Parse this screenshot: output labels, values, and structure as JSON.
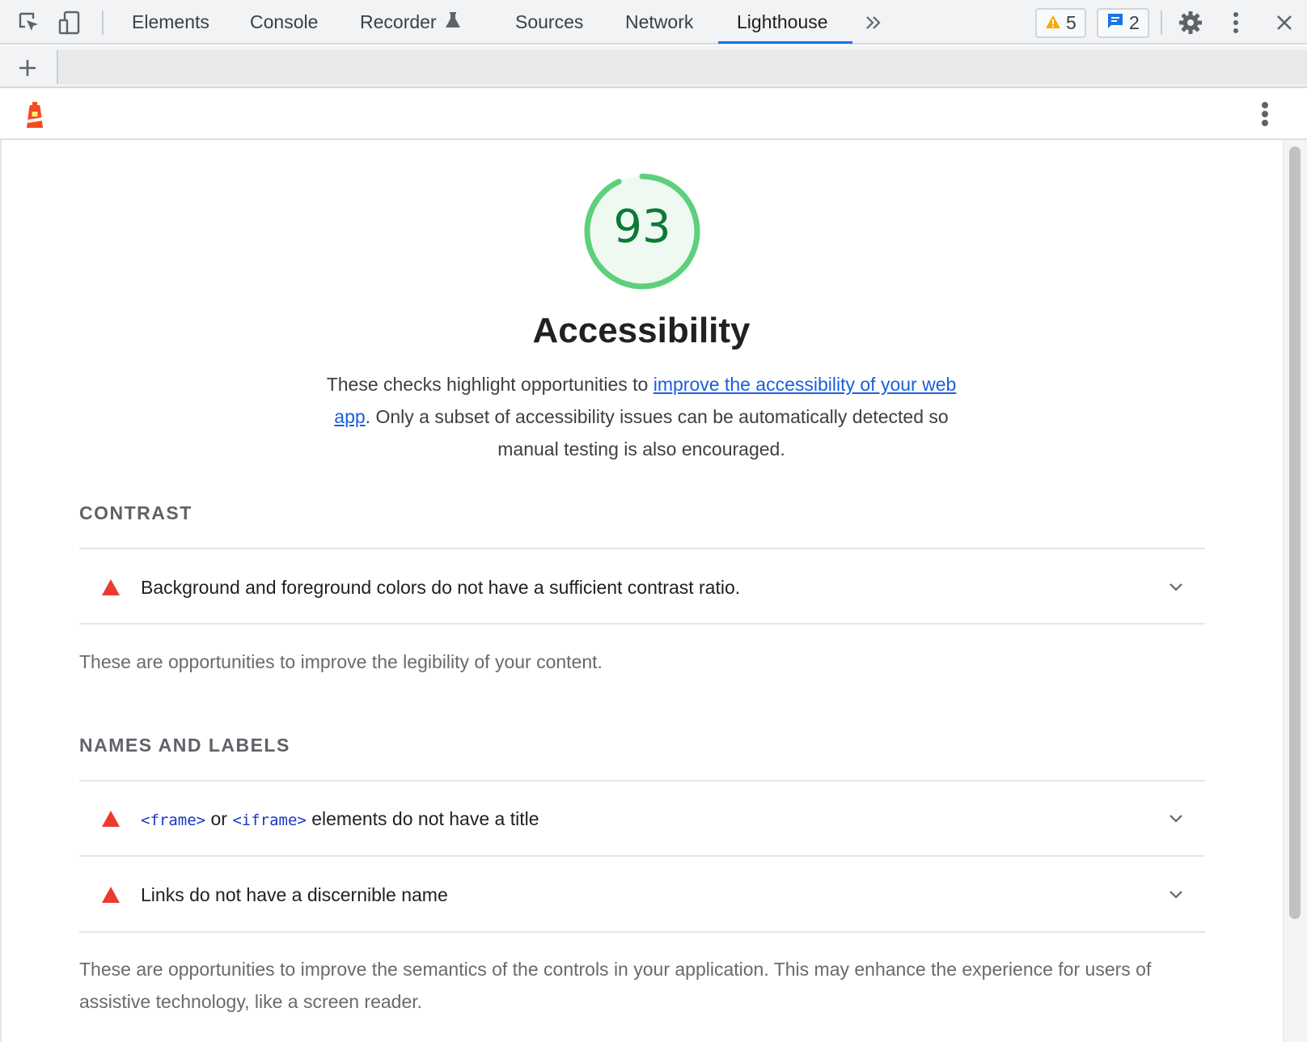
{
  "devtools": {
    "tabs": [
      {
        "label": "Elements"
      },
      {
        "label": "Console"
      },
      {
        "label": "Recorder"
      },
      {
        "label": "Sources"
      },
      {
        "label": "Network"
      },
      {
        "label": "Lighthouse",
        "active": true
      }
    ],
    "icons": [
      "inspect-element-icon",
      "device-toolbar-icon",
      "flask-icon",
      "more-tabs-icon",
      "warning-icon",
      "message-icon",
      "gear-icon",
      "kebab-menu-icon",
      "close-icon"
    ],
    "warnings_count": "5",
    "messages_count": "2",
    "accent_color": "#1a73e8"
  },
  "toolbar": {
    "new_report_icon": "plus-icon",
    "report_select_value": ""
  },
  "report": {
    "logo": "lighthouse-logo",
    "menu_icon": "kebab-menu-icon",
    "score": "93",
    "score_fraction": 0.93,
    "score_color": "#0cce6b",
    "category_title": "Accessibility",
    "description_before": "These checks highlight opportunities to ",
    "description_link": "improve the accessibility of your web app",
    "description_after": ". Only a subset of accessibility issues can be automatically detected so manual testing is also encouraged.",
    "groups": [
      {
        "title": "CONTRAST",
        "audits": [
          {
            "text": "Background and foreground colors do not have a sufficient contrast ratio."
          }
        ],
        "description": "These are opportunities to improve the legibility of your content."
      },
      {
        "title": "NAMES AND LABELS",
        "audits": [
          {
            "code1": "<frame>",
            "or": " or ",
            "code2": "<iframe>",
            "rest": " elements do not have a title"
          },
          {
            "text": "Links do not have a discernible name"
          }
        ],
        "description": "These are opportunities to improve the semantics of the controls in your application. This may enhance the experience for users of assistive technology, like a screen reader."
      }
    ],
    "fail_color": "#eb3b2f"
  }
}
